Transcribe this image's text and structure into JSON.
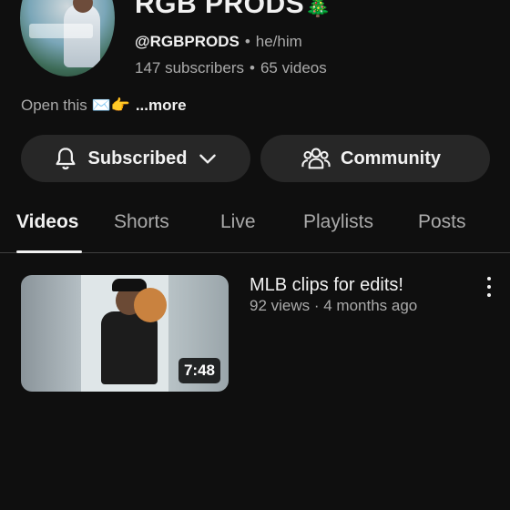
{
  "channel": {
    "name": "RGB PRODS",
    "name_emoji": "🎄",
    "handle": "@RGBPRODS",
    "pronouns": "he/him",
    "subscribers": "147 subscribers",
    "videos": "65 videos",
    "separator": "•",
    "description": "Open this ✉️👉",
    "more_label": "...more"
  },
  "actions": {
    "subscribed_label": "Subscribed",
    "community_label": "Community"
  },
  "tabs": [
    {
      "label": "Videos"
    },
    {
      "label": "Shorts"
    },
    {
      "label": "Live"
    },
    {
      "label": "Playlists"
    },
    {
      "label": "Posts"
    }
  ],
  "active_tab": "Videos",
  "videos": [
    {
      "title": "MLB clips for edits!",
      "meta": "92 views · 4 months ago",
      "duration": "7:48"
    }
  ],
  "icons": {
    "subscribe_bell": "bell-icon",
    "subscribe_chevron": "chevron-down-icon",
    "community": "community-icon",
    "video_menu": "more-vert-icon"
  },
  "colors": {
    "background": "#0f0f0f",
    "pill": "#272727",
    "text": "#f1f1f1",
    "muted": "#aaaaaa"
  }
}
